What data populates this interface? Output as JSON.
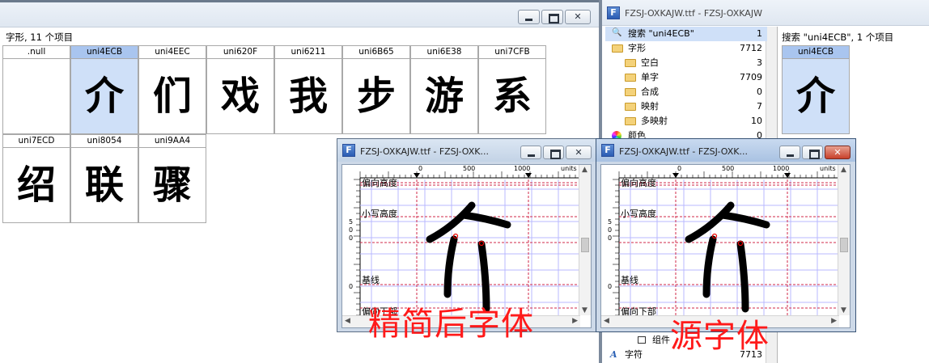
{
  "left_window": {
    "count_label": "字形, 11 个项目",
    "glyphs": [
      {
        "name": ".null",
        "char": ""
      },
      {
        "name": "uni4ECB",
        "char": "介",
        "selected": true
      },
      {
        "name": "uni4EEC",
        "char": "们"
      },
      {
        "name": "uni620F",
        "char": "戏"
      },
      {
        "name": "uni6211",
        "char": "我"
      },
      {
        "name": "uni6B65",
        "char": "步"
      },
      {
        "name": "uni6E38",
        "char": "游"
      },
      {
        "name": "uni7CFB",
        "char": "系"
      },
      {
        "name": "uni7ECD",
        "char": "绍"
      },
      {
        "name": "uni8054",
        "char": "联"
      },
      {
        "name": "uni9AA4",
        "char": "骤"
      }
    ]
  },
  "right_window": {
    "title": "FZSJ-OXKAJW.ttf - FZSJ-OXKAJW",
    "tree": [
      {
        "label": "搜索 \"uni4ECB\"",
        "value": "1",
        "icon": "search-icon",
        "selected": true
      },
      {
        "label": "字形",
        "value": "7712",
        "icon": "folder-icon"
      },
      {
        "label": "空白",
        "value": "3",
        "icon": "folder-icon"
      },
      {
        "label": "单字",
        "value": "7709",
        "icon": "folder-icon"
      },
      {
        "label": "合成",
        "value": "0",
        "icon": "folder-icon"
      },
      {
        "label": "映射",
        "value": "7",
        "icon": "folder-icon"
      },
      {
        "label": "多映射",
        "value": "10",
        "icon": "folder-icon"
      },
      {
        "label": "颜色",
        "value": "0",
        "icon": "color-wheel-icon"
      }
    ],
    "bottom_items": [
      {
        "label": "组件",
        "value": ""
      },
      {
        "label": "字符",
        "value": "7713"
      }
    ],
    "search_result_label": "搜索 \"uni4ECB\", 1 个项目",
    "search_result": {
      "name": "uni4ECB",
      "char": "介"
    }
  },
  "editors": [
    {
      "title": "FZSJ-OXKAJW.ttf - FZSJ-OXK...",
      "ruler_top": [
        "0",
        "500",
        "1000",
        "units"
      ],
      "ruler_left": [
        "5",
        "0",
        "0",
        "0"
      ],
      "guides": [
        "偏向高度",
        "小写高度",
        "基线",
        "偏向下部"
      ],
      "char": "介",
      "caption": "精简后字体",
      "active": false
    },
    {
      "title": "FZSJ-OXKAJW.ttf - FZSJ-OXK...",
      "ruler_top": [
        "0",
        "500",
        "1000",
        "units"
      ],
      "ruler_left": [
        "5",
        "0",
        "0",
        "0"
      ],
      "guides": [
        "偏向高度",
        "小写高度",
        "基线",
        "偏向下部"
      ],
      "char": "介",
      "caption": "源字体",
      "active": true
    }
  ]
}
